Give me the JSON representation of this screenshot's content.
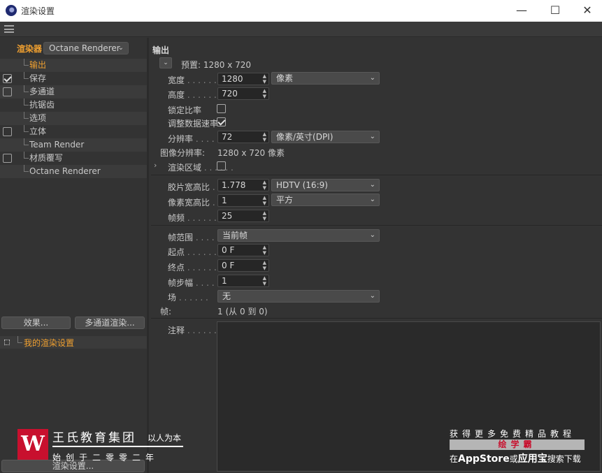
{
  "window": {
    "title": "渲染设置",
    "minimize_glyph": "—",
    "maximize_glyph": "☐",
    "close_glyph": "✕"
  },
  "menu": {
    "icon": "hamburger-menu-icon"
  },
  "renderer": {
    "label": "渲染器",
    "selected": "Octane Renderer"
  },
  "tree": {
    "items": [
      {
        "label": "输出",
        "checkbox": null,
        "active": true
      },
      {
        "label": "保存",
        "checkbox": true
      },
      {
        "label": "多通道",
        "checkbox": false
      },
      {
        "label": "抗锯齿",
        "checkbox": null
      },
      {
        "label": "选项",
        "checkbox": null
      },
      {
        "label": "立体",
        "checkbox": false
      },
      {
        "label": "Team Render",
        "checkbox": null
      },
      {
        "label": "材质覆写",
        "checkbox": false
      },
      {
        "label": "Octane Renderer",
        "checkbox": null
      }
    ]
  },
  "buttons": {
    "effects": "效果...",
    "multipass_render": "多通道渲染...",
    "render_settings": "渲染设置..."
  },
  "preset_list": {
    "item": "我的渲染设置"
  },
  "output": {
    "section_title": "输出",
    "preset_toggle": "⌄",
    "preset_text": "预置: 1280 x 720",
    "width_label": "宽度",
    "width_value": "1280",
    "unit_select": "像素",
    "height_label": "高度",
    "height_value": "720",
    "lock_ratio_label": "锁定比率",
    "lock_ratio": false,
    "adjust_rate_label": "调整数据速率",
    "adjust_rate": true,
    "resolution_label": "分辨率",
    "resolution_value": "72",
    "resolution_unit": "像素/英寸(DPI)",
    "image_res_label": "图像分辨率:",
    "image_res_value": "1280 x 720 像素",
    "render_region_label": "渲染区域",
    "render_region": false,
    "expand_glyph": "›",
    "film_aspect_label": "胶片宽高比",
    "film_aspect_value": "1.778",
    "film_aspect_preset": "HDTV (16:9)",
    "pixel_aspect_label": "像素宽高比",
    "pixel_aspect_value": "1",
    "pixel_aspect_preset": "平方",
    "fps_label": "帧频",
    "fps_value": "25",
    "frame_range_label": "帧范围",
    "frame_range_value": "当前帧",
    "start_label": "起点",
    "start_value": "0 F",
    "end_label": "终点",
    "end_value": "0 F",
    "frame_step_label": "帧步幅",
    "frame_step_value": "1",
    "field_label": "场",
    "field_value": "无",
    "frames_label": "帧:",
    "frames_value": "1 (从 0 到 0)",
    "notes_label": "注释"
  },
  "watermark_left": {
    "logo": "W",
    "name": "王氏教育集团",
    "slogan": "以人为本",
    "sub": "始创于二零零二年"
  },
  "watermark_right": {
    "line1": "获得更多免费精品教程",
    "line2": "绘学霸",
    "line3_prefix": "在",
    "line3_store": "AppStore",
    "line3_mid": "或",
    "line3_app": "应用宝",
    "line3_suffix": "搜索下载"
  }
}
